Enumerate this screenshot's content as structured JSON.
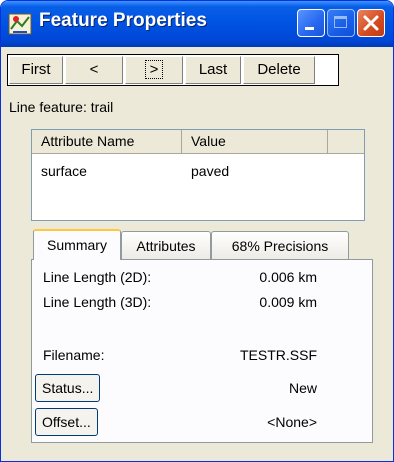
{
  "window": {
    "title": "Feature Properties",
    "title_color": "#0054e3"
  },
  "nav": {
    "buttons": [
      {
        "label": "First"
      },
      {
        "label": "<"
      },
      {
        "label": ">"
      },
      {
        "label": "Last"
      },
      {
        "label": "Delete"
      }
    ]
  },
  "feature_label": "Line feature: trail",
  "attributes_table": {
    "columns": [
      "Attribute Name",
      "Value"
    ],
    "rows": [
      {
        "name": "surface",
        "value": "paved"
      }
    ]
  },
  "tabs": [
    {
      "label": "Summary",
      "active": true
    },
    {
      "label": "Attributes",
      "active": false
    },
    {
      "label": "68% Precisions",
      "active": false
    }
  ],
  "summary": {
    "line_length_2d_label": "Line Length (2D):",
    "line_length_2d_value": "0.006 km",
    "line_length_3d_label": "Line Length (3D):",
    "line_length_3d_value": "0.009 km",
    "filename_label": "Filename:",
    "filename_value": "TESTR.SSF",
    "status_button": "Status...",
    "status_value": "New",
    "offset_button": "Offset...",
    "offset_value": "<None>"
  },
  "icons": {
    "app": "map-icon",
    "minimize": "minimize-icon",
    "maximize": "maximize-icon",
    "close": "close-icon"
  }
}
